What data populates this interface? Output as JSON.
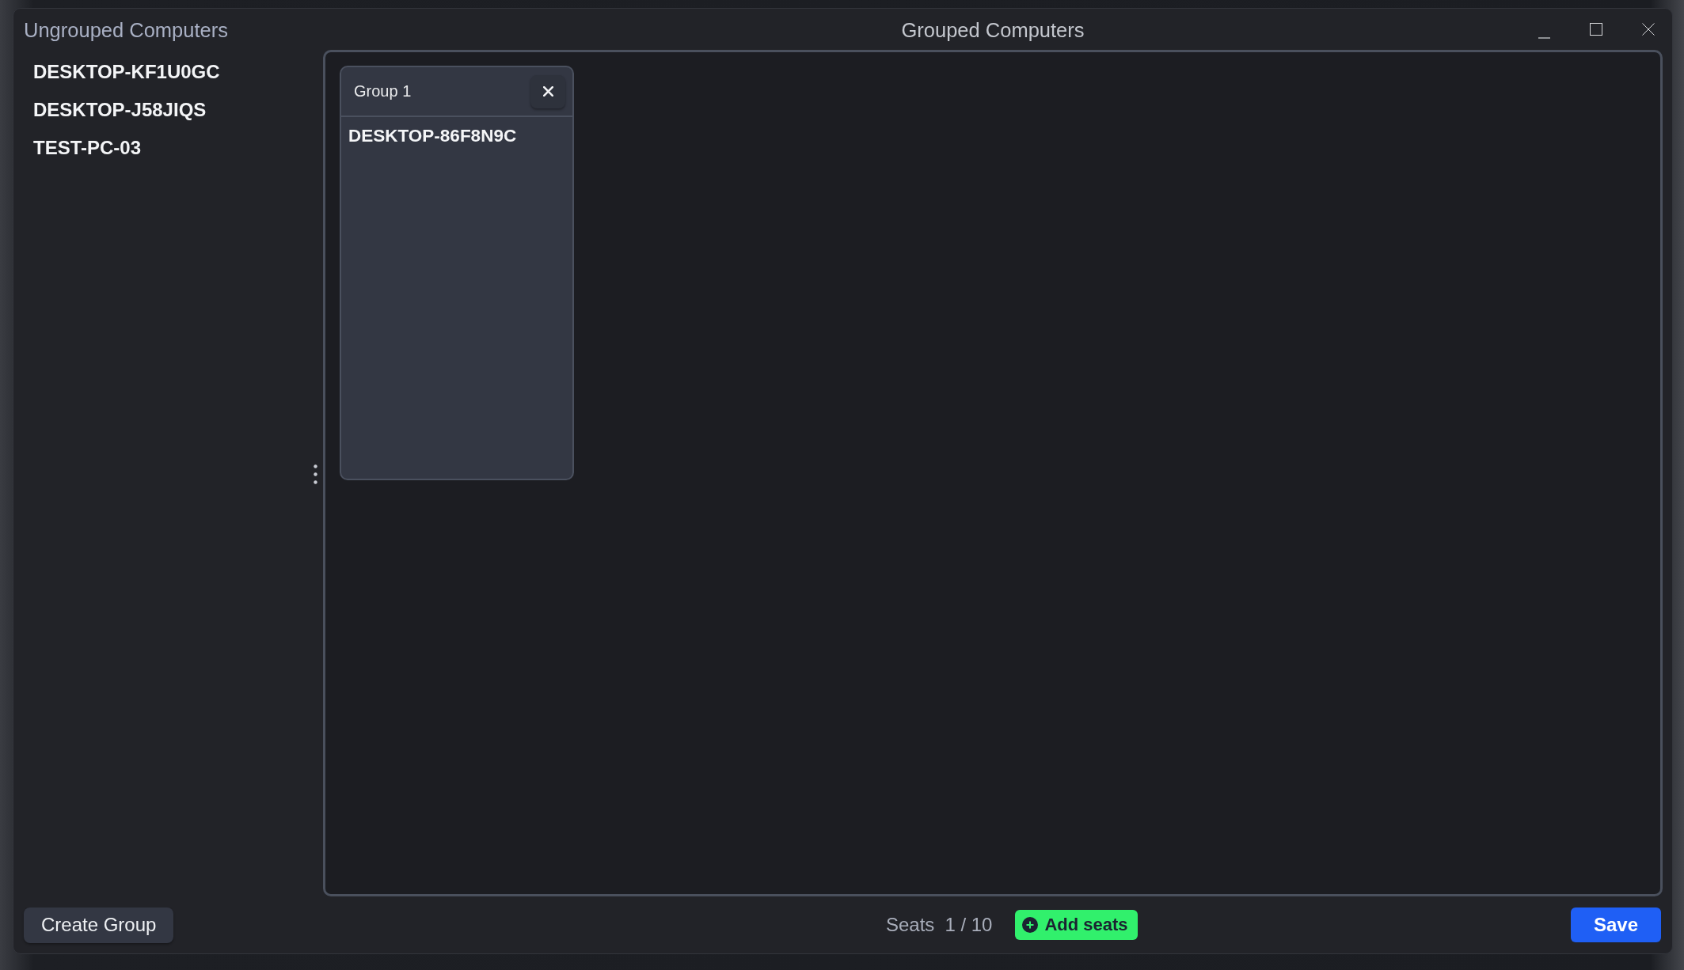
{
  "ungrouped": {
    "title": "Ungrouped Computers",
    "computers": [
      "DESKTOP-KF1U0GC",
      "DESKTOP-J58JIQS",
      "TEST-PC-03"
    ]
  },
  "grouped": {
    "title": "Grouped Computers",
    "groups": [
      {
        "name": "Group 1",
        "computers": [
          "DESKTOP-86F8N9C"
        ]
      }
    ]
  },
  "footer": {
    "create_group_button": "Create Group",
    "seats_label": "Seats",
    "seats_count": "1 / 10",
    "add_seats_button": "Add seats",
    "save_button": "Save"
  }
}
